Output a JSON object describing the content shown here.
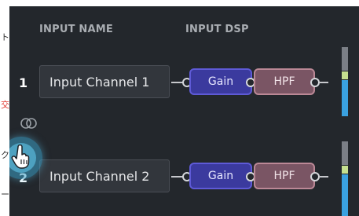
{
  "page_edge": {
    "glyphs": [
      "ト",
      "交",
      "ク",
      "ー"
    ]
  },
  "header": {
    "input_name": "INPUT NAME",
    "input_dsp": "INPUT DSP"
  },
  "channels": [
    {
      "number": "1",
      "name": "Input Channel 1",
      "dsp": [
        {
          "label": "Gain",
          "type": "gain"
        },
        {
          "label": "HPF",
          "type": "hpf"
        }
      ],
      "meter": {
        "active_color": "#3aa1e0",
        "peak_color": "#c5e08f",
        "idle_color": "#7b7f86"
      }
    },
    {
      "number": "2",
      "name": "Input Channel 2",
      "dsp": [
        {
          "label": "Gain",
          "type": "gain"
        },
        {
          "label": "HPF",
          "type": "hpf"
        }
      ],
      "meter": {
        "active_color": "#3aa1e0",
        "peak_color": "#c5e08f",
        "idle_color": "#7b7f86"
      }
    }
  ],
  "icons": {
    "link": "link-rings-icon",
    "cursor": "touch-hand-icon"
  },
  "colors": {
    "panel_bg": "#23272c",
    "gain_block": "#3b3a9e",
    "hpf_block": "#7a5564"
  }
}
